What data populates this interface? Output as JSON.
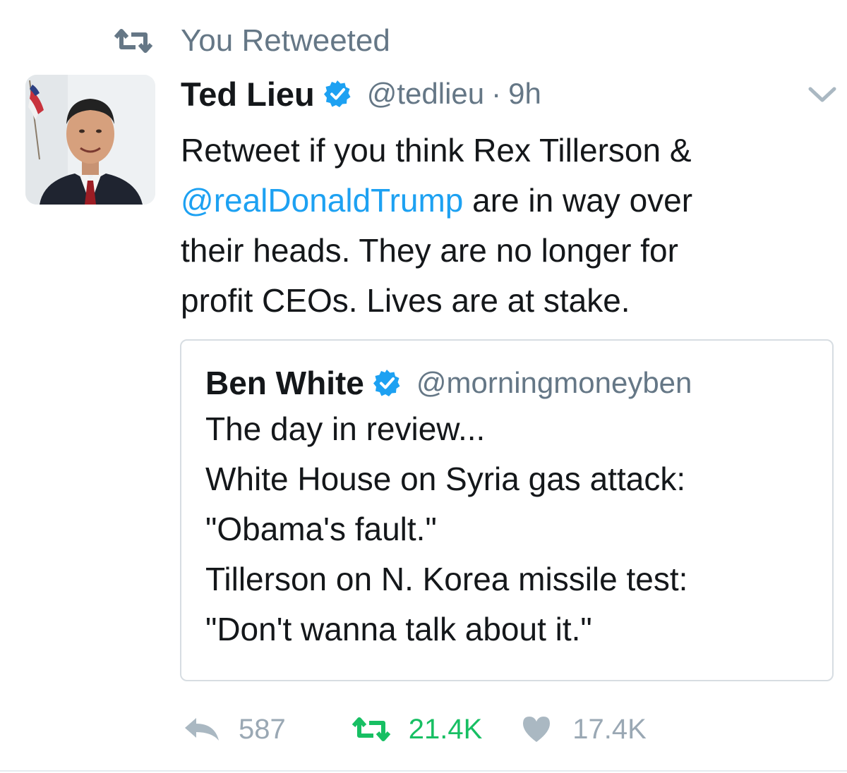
{
  "context": {
    "icon": "retweet-icon",
    "label": "You Retweeted"
  },
  "tweet": {
    "author_name": "Ted Lieu",
    "verified_icon": "verified-badge-icon",
    "handle": "@tedlieu",
    "separator": "·",
    "time": "9h",
    "menu_icon": "chevron-down-icon",
    "text": {
      "line1": "Retweet if you think Rex Tillerson &",
      "mention": "@realDonaldTrump",
      "line2_rest": " are in way over",
      "line3": "their heads. They are no longer for",
      "line4": "profit CEOs. Lives are at stake."
    },
    "mention_color": "#1da1f2"
  },
  "quote": {
    "author_name": "Ben White",
    "verified_icon": "verified-badge-icon",
    "handle": "@morningmoneyben",
    "lines": [
      "The day in review...",
      "White House on Syria gas attack:",
      "\"Obama's fault.\"",
      "Tillerson on N. Korea missile test:",
      "\"Don't wanna talk about it.\""
    ]
  },
  "actions": {
    "reply": {
      "icon": "reply-icon",
      "count": "587"
    },
    "retweet": {
      "icon": "retweet-icon",
      "count": "21.4K",
      "color": "#17bf63",
      "active": true
    },
    "like": {
      "icon": "heart-icon",
      "count": "17.4K"
    }
  }
}
